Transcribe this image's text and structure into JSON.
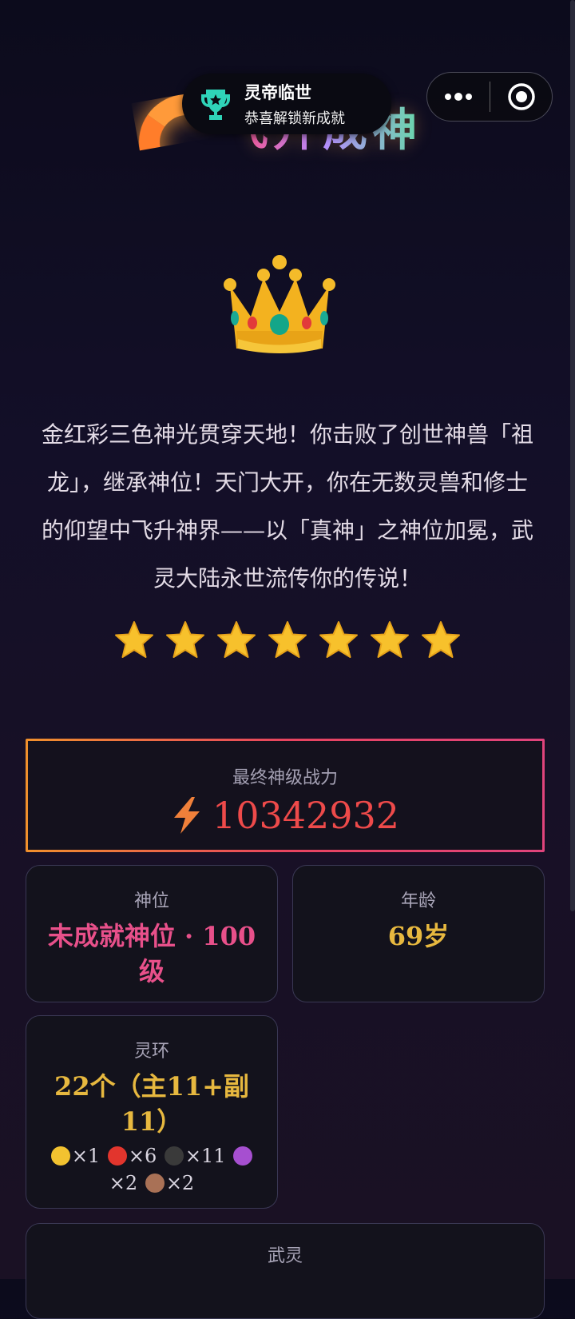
{
  "title": "飞升成神",
  "toast": {
    "title": "灵帝临世",
    "subtitle": "恭喜解锁新成就",
    "icon": "trophy-icon"
  },
  "capsule": {
    "more_icon": "more-dots-icon",
    "close_icon": "target-close-icon"
  },
  "story": "金红彩三色神光贯穿天地！你击败了创世神兽「祖龙」，继承神位！天门大开，你在无数灵兽和修士的仰望中飞升神界——以「真神」之神位加冕，武灵大陆永世流传你的传说！",
  "stars": 7,
  "power": {
    "label": "最终神级战力",
    "value": "10342932"
  },
  "god_rank": {
    "label": "神位",
    "value": "未成就神位 · 100级"
  },
  "age": {
    "label": "年龄",
    "value": "69岁"
  },
  "rings": {
    "label": "灵环",
    "value": "22个（主11+副11）",
    "counts": [
      {
        "color": "#f2c230",
        "count": "×1"
      },
      {
        "color": "#e2352d",
        "count": "×6"
      },
      {
        "color": "#3a3a3a",
        "count": "×11"
      },
      {
        "color": "#a64fd0",
        "count": "×2"
      },
      {
        "color": "#a97156",
        "count": "×2"
      }
    ]
  },
  "martial_soul": {
    "label": "武灵"
  },
  "colors": {
    "accent_red": "#ee4a4a",
    "pink": "#e8508a",
    "gold": "#e7b83f"
  }
}
